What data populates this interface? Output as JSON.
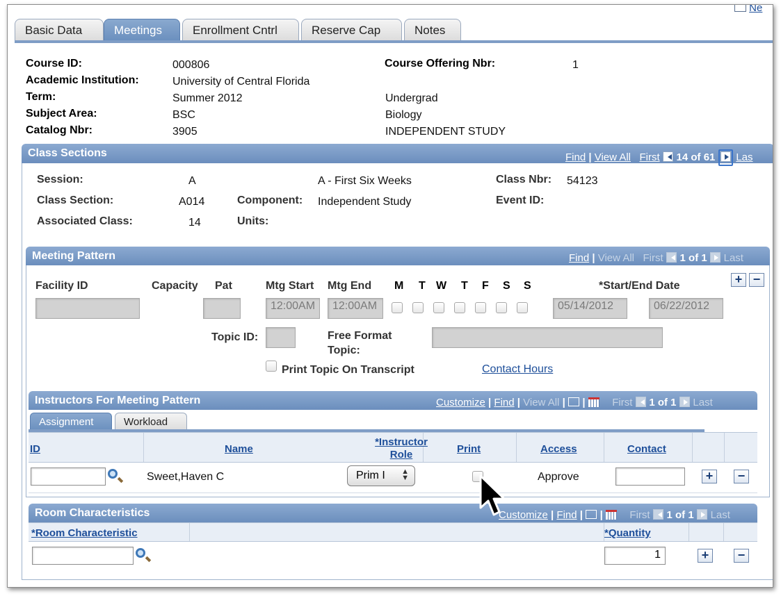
{
  "tabs": [
    {
      "label": "Basic Data",
      "active": false
    },
    {
      "label": "Meetings",
      "active": true
    },
    {
      "label": "Enrollment Cntrl",
      "active": false
    },
    {
      "label": "Reserve Cap",
      "active": false
    },
    {
      "label": "Notes",
      "active": false
    }
  ],
  "top_right_link": "Ne",
  "course": {
    "course_id_label": "Course ID:",
    "course_id": "000806",
    "institution_label": "Academic Institution:",
    "institution": "University of Central Florida",
    "term_label": "Term:",
    "term": "Summer 2012",
    "career": "Undergrad",
    "subject_label": "Subject Area:",
    "subject": "BSC",
    "subject_desc": "Biology",
    "catalog_label": "Catalog Nbr:",
    "catalog": "3905",
    "catalog_desc": "INDEPENDENT STUDY",
    "offering_label": "Course Offering Nbr:",
    "offering": "1"
  },
  "class_sections": {
    "title": "Class Sections",
    "find": "Find",
    "view_all": "View All",
    "first": "First",
    "count": "14 of 61",
    "last": "Las",
    "session_label": "Session:",
    "session": "A",
    "session_desc": "A - First Six Weeks",
    "class_nbr_label": "Class Nbr:",
    "class_nbr": "54123",
    "section_label": "Class Section:",
    "section": "A014",
    "component_label": "Component:",
    "component": "Independent Study",
    "event_label": "Event ID:",
    "assoc_label": "Associated Class:",
    "assoc": "14",
    "units_label": "Units:"
  },
  "meeting_pattern": {
    "title": "Meeting Pattern",
    "find": "Find",
    "view_all": "View All",
    "first": "First",
    "count": "1 of 1",
    "last": "Last",
    "facility_label": "Facility ID",
    "capacity_label": "Capacity",
    "pat_label": "Pat",
    "mtg_start_label": "Mtg Start",
    "mtg_end_label": "Mtg End",
    "days": [
      "M",
      "T",
      "W",
      "T",
      "F",
      "S",
      "S"
    ],
    "date_label": "*Start/End Date",
    "mtg_start": "12:00AM",
    "mtg_end": "12:00AM",
    "start_date": "05/14/2012",
    "end_date": "06/22/2012",
    "topic_label": "Topic ID:",
    "free_format_label_1": "Free Format",
    "free_format_label_2": "Topic:",
    "print_topic_label": "Print Topic On Transcript",
    "contact_hours": "Contact Hours",
    "plus": "+",
    "minus": "−"
  },
  "instructors": {
    "title": "Instructors For Meeting Pattern",
    "customize": "Customize",
    "find": "Find",
    "view_all": "View All",
    "first": "First",
    "count": "1 of 1",
    "last": "Last",
    "subtabs": [
      "Assignment",
      "Workload"
    ],
    "columns": {
      "id": "ID",
      "name": "Name",
      "role_1": "*Instructor",
      "role_2": "Role",
      "print": "Print",
      "access": "Access",
      "contact": "Contact"
    },
    "row": {
      "name": "Sweet,Haven C",
      "role": "Prim I",
      "access": "Approve"
    }
  },
  "room": {
    "title": "Room Characteristics",
    "customize": "Customize",
    "find": "Find",
    "first": "First",
    "count": "1 of 1",
    "last": "Last",
    "col_char": "*Room Characteristic",
    "col_qty": "*Quantity",
    "quantity": "1"
  }
}
